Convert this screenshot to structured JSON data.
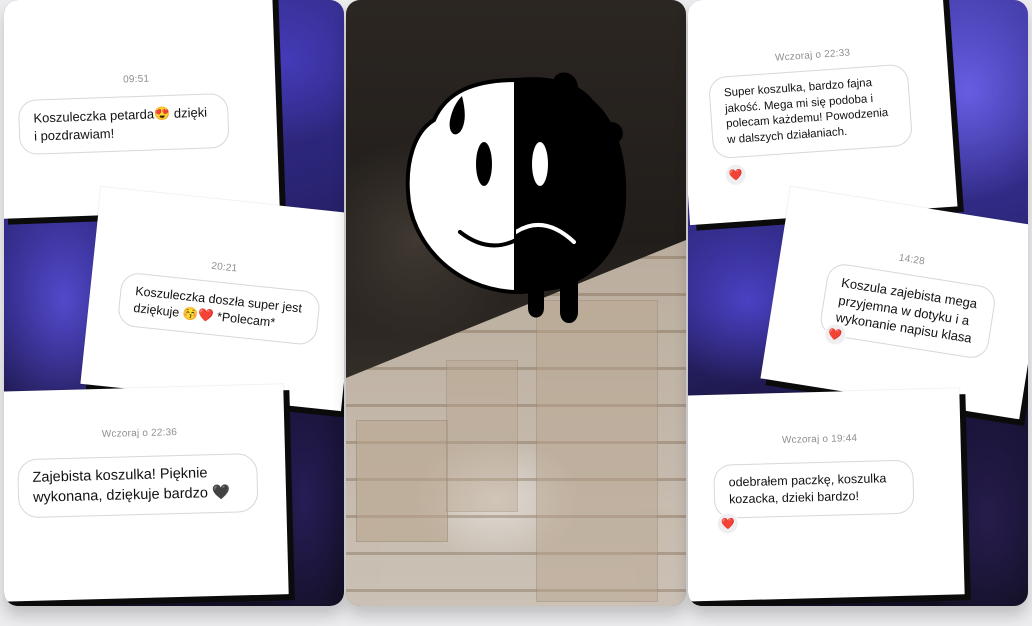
{
  "left_panel": {
    "card1": {
      "time": "09:51",
      "text": "Koszuleczka petarda😍 dzięki i pozdrawiam!"
    },
    "card2": {
      "time": "20:21",
      "text": "Koszuleczka doszła super jest dziękuje 😚❤️ *Polecam*"
    },
    "card3": {
      "time": "Wczoraj o 22:36",
      "text": "Zajebista koszulka! Pięknie wykonana, dziękuje bardzo 🖤"
    }
  },
  "middle_panel": {
    "logo_icon": "half-smile-half-sad-dripping-face-icon",
    "colors": {
      "logo_white": "#ffffff",
      "logo_black": "#000000"
    }
  },
  "right_panel": {
    "card1": {
      "time": "Wczoraj o 22:33",
      "text": "Super koszulka, bardzo fajna jakość. Mega mi się podoba i polecam każdemu! Powodzenia w dalszych działaniach.",
      "reaction": "❤️"
    },
    "card2": {
      "time": "14:28",
      "text": "Koszula zajebista mega przyjemna w dotyku i a wykonanie napisu klasa",
      "reaction": "❤️"
    },
    "card3": {
      "time": "Wczoraj o 19:44",
      "text": "odebrałem paczkę, koszulka kozacka, dzieki bardzo!",
      "reaction": "❤️"
    }
  }
}
